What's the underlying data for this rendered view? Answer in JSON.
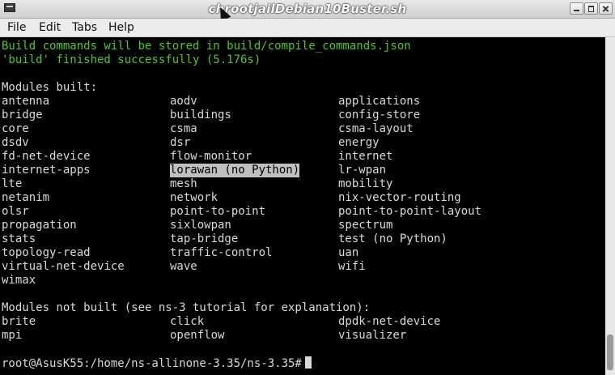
{
  "window": {
    "title": "chrootjailDebian10Buster.sh"
  },
  "menu": [
    "File",
    "Edit",
    "Tabs",
    "Help"
  ],
  "terminal": {
    "line1": "Build commands will be stored in build/compile_commands.json",
    "line2": "'build' finished successfully (5.176s)",
    "built_header": "Modules built:",
    "built_rows": [
      [
        "antenna",
        "aodv",
        "applications"
      ],
      [
        "bridge",
        "buildings",
        "config-store"
      ],
      [
        "core",
        "csma",
        "csma-layout"
      ],
      [
        "dsdv",
        "dsr",
        "energy"
      ],
      [
        "fd-net-device",
        "flow-monitor",
        "internet"
      ],
      [
        "internet-apps",
        "lorawan (no Python)",
        "lr-wpan"
      ],
      [
        "lte",
        "mesh",
        "mobility"
      ],
      [
        "netanim",
        "network",
        "nix-vector-routing"
      ],
      [
        "olsr",
        "point-to-point",
        "point-to-point-layout"
      ],
      [
        "propagation",
        "sixlowpan",
        "spectrum"
      ],
      [
        "stats",
        "tap-bridge",
        "test (no Python)"
      ],
      [
        "topology-read",
        "traffic-control",
        "uan"
      ],
      [
        "virtual-net-device",
        "wave",
        "wifi"
      ],
      [
        "wimax",
        "",
        ""
      ]
    ],
    "highlighted": "lorawan (no Python)",
    "not_built_header": "Modules not built (see ns-3 tutorial for explanation):",
    "not_built_rows": [
      [
        "brite",
        "click",
        "dpdk-net-device"
      ],
      [
        "mpi",
        "openflow",
        "visualizer"
      ]
    ],
    "prompt": "root@AsusK55:/home/ns-allinone-3.35/ns-3.35#"
  },
  "colors": {
    "success_text": "#52c81e",
    "terminal_bg": "#000000",
    "terminal_fg": "#d9d9d9",
    "selection_bg": "#c0c0c0"
  }
}
